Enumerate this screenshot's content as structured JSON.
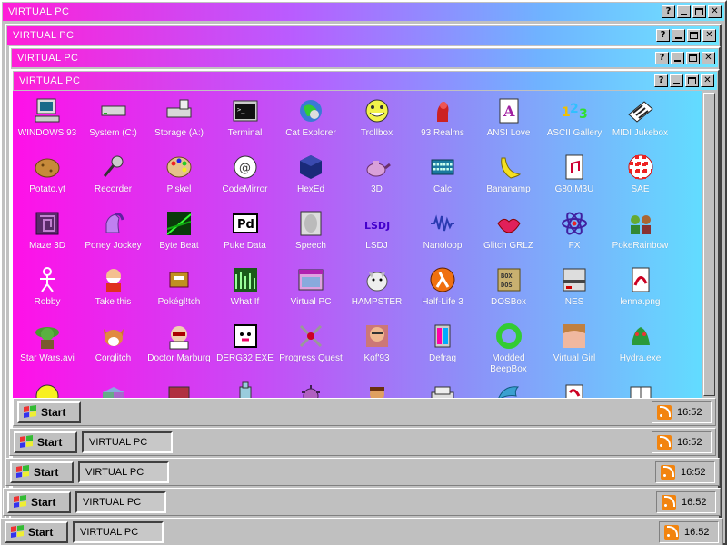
{
  "window_title": "VIRTUAL PC",
  "title_buttons": {
    "help": "?",
    "close": "✕"
  },
  "colors": {
    "gradient_start": "#ff10e8",
    "gradient_end": "#62dcff",
    "chrome": "#c0c0c0",
    "rss": "#f2840f"
  },
  "desktop_icons": [
    {
      "label": "WINDOWS 93",
      "icon": "computer-icon"
    },
    {
      "label": "System (C:)",
      "icon": "drive-icon"
    },
    {
      "label": "Storage (A:)",
      "icon": "floppy-drive-icon"
    },
    {
      "label": "Terminal",
      "icon": "terminal-icon"
    },
    {
      "label": "Cat Explorer",
      "icon": "cat-globe-icon"
    },
    {
      "label": "Trollbox",
      "icon": "trollface-icon"
    },
    {
      "label": "93 Realms",
      "icon": "knight-icon"
    },
    {
      "label": "ANSI Love",
      "icon": "ansi-icon"
    },
    {
      "label": "ASCII Gallery",
      "icon": "numbers-icon"
    },
    {
      "label": "MIDI Jukebox",
      "icon": "piano-icon"
    },
    {
      "label": "Potato.yt",
      "icon": "potato-icon"
    },
    {
      "label": "Recorder",
      "icon": "microphone-icon"
    },
    {
      "label": "Piskel",
      "icon": "palette-icon"
    },
    {
      "label": "CodeMirror",
      "icon": "codemirror-icon"
    },
    {
      "label": "HexEd",
      "icon": "cube-icon"
    },
    {
      "label": "3D",
      "icon": "teapot-icon"
    },
    {
      "label": "Calc",
      "icon": "calculator-icon"
    },
    {
      "label": "Bananamp",
      "icon": "banana-icon"
    },
    {
      "label": "G80.M3U",
      "icon": "music-file-icon"
    },
    {
      "label": "SAE",
      "icon": "amiga-ball-icon"
    },
    {
      "label": "Maze 3D",
      "icon": "maze-icon"
    },
    {
      "label": "Poney Jockey",
      "icon": "pony-icon"
    },
    {
      "label": "Byte Beat",
      "icon": "bytebeat-icon"
    },
    {
      "label": "Puke Data",
      "icon": "pd-icon"
    },
    {
      "label": "Speech",
      "icon": "face-icon"
    },
    {
      "label": "LSDJ",
      "icon": "lsdj-icon"
    },
    {
      "label": "Nanoloop",
      "icon": "wave-icon"
    },
    {
      "label": "Glitch GRLZ",
      "icon": "lips-icon"
    },
    {
      "label": "FX",
      "icon": "atom-icon"
    },
    {
      "label": "PokeRainbow",
      "icon": "pokerainbow-icon"
    },
    {
      "label": "Robby",
      "icon": "stick-figure-icon"
    },
    {
      "label": "Take this",
      "icon": "old-man-icon"
    },
    {
      "label": "Pokégl!tch",
      "icon": "glitch-poke-icon"
    },
    {
      "label": "What If",
      "icon": "whatif-icon"
    },
    {
      "label": "Virtual PC",
      "icon": "window-icon"
    },
    {
      "label": "HAMPSTER",
      "icon": "hamster-icon"
    },
    {
      "label": "Half-Life 3",
      "icon": "lambda-icon"
    },
    {
      "label": "DOSBox",
      "icon": "dosbox-icon"
    },
    {
      "label": "NES",
      "icon": "nes-icon"
    },
    {
      "label": "lenna.png",
      "icon": "image-file-icon"
    },
    {
      "label": "Star Wars.avi",
      "icon": "yoda-icon"
    },
    {
      "label": "Corglitch",
      "icon": "corgi-icon"
    },
    {
      "label": "Doctor Marburg",
      "icon": "doctor-icon"
    },
    {
      "label": "DERG32.EXE",
      "icon": "derg-icon"
    },
    {
      "label": "Progress Quest",
      "icon": "swords-icon"
    },
    {
      "label": "Kof'93",
      "icon": "fighter-icon"
    },
    {
      "label": "Defrag",
      "icon": "defrag-icon"
    },
    {
      "label": "Modded BeepBox",
      "icon": "ring-icon"
    },
    {
      "label": "Virtual Girl",
      "icon": "girl-icon"
    },
    {
      "label": "Hydra.exe",
      "icon": "hydra-icon"
    },
    {
      "label": "",
      "icon": "smiley-icon"
    },
    {
      "label": "",
      "icon": "box-icon"
    },
    {
      "label": "",
      "icon": "disk-icon"
    },
    {
      "label": "",
      "icon": "bottle-icon"
    },
    {
      "label": "",
      "icon": "virus-icon"
    },
    {
      "label": "",
      "icon": "man-icon"
    },
    {
      "label": "",
      "icon": "printer-icon"
    },
    {
      "label": "",
      "icon": "dolphin-icon"
    },
    {
      "label": "",
      "icon": "document-icon"
    },
    {
      "label": "",
      "icon": "book-icon"
    }
  ],
  "taskbars": [
    {
      "start": "Start",
      "task": "",
      "clock": "16:52"
    },
    {
      "start": "Start",
      "task": "VIRTUAL PC",
      "clock": "16:52"
    },
    {
      "start": "Start",
      "task": "VIRTUAL PC",
      "clock": "16:52"
    },
    {
      "start": "Start",
      "task": "VIRTUAL PC",
      "clock": "16:52"
    },
    {
      "start": "Start",
      "task": "VIRTUAL PC",
      "clock": "16:52"
    }
  ]
}
